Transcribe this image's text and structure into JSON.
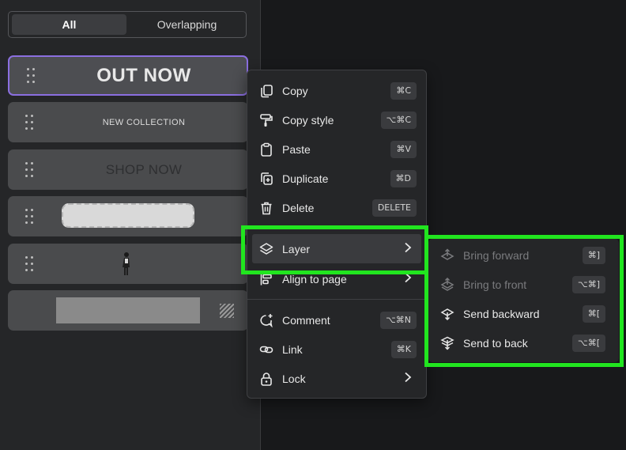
{
  "layers_panel": {
    "tabs": [
      {
        "label": "All",
        "selected": true
      },
      {
        "label": "Overlapping",
        "selected": false
      }
    ],
    "rows": [
      {
        "text": "OUT NOW",
        "selected": true
      },
      {
        "text": "NEW COLLECTION"
      },
      {
        "text": "SHOP NOW"
      },
      {
        "kind": "rounded-rectangle-shape"
      },
      {
        "kind": "person-photo"
      },
      {
        "kind": "rectangle-with-pattern"
      }
    ]
  },
  "context_menu": {
    "items": [
      {
        "label": "Copy",
        "shortcut": "⌘C",
        "icon": "copy-icon"
      },
      {
        "label": "Copy style",
        "shortcut": "⌥⌘C",
        "icon": "paint-roller-icon"
      },
      {
        "label": "Paste",
        "shortcut": "⌘V",
        "icon": "clipboard-icon"
      },
      {
        "label": "Duplicate",
        "shortcut": "⌘D",
        "icon": "duplicate-icon"
      },
      {
        "label": "Delete",
        "shortcut": "DELETE",
        "icon": "trash-icon"
      },
      {
        "label": "Layer",
        "icon": "layers-icon",
        "submenu": true,
        "highlighted": true
      },
      {
        "label": "Align to page",
        "icon": "align-icon",
        "submenu": true
      },
      {
        "label": "Comment",
        "shortcut": "⌥⌘N",
        "icon": "comment-icon"
      },
      {
        "label": "Link",
        "shortcut": "⌘K",
        "icon": "link-icon"
      },
      {
        "label": "Lock",
        "icon": "lock-icon",
        "submenu": true
      }
    ]
  },
  "layer_submenu": {
    "items": [
      {
        "label": "Bring forward",
        "shortcut": "⌘]",
        "disabled": true,
        "icon": "bring-forward-icon"
      },
      {
        "label": "Bring to front",
        "shortcut": "⌥⌘]",
        "disabled": true,
        "icon": "bring-to-front-icon"
      },
      {
        "label": "Send backward",
        "shortcut": "⌘[",
        "disabled": false,
        "icon": "send-backward-icon"
      },
      {
        "label": "Send to back",
        "shortcut": "⌥⌘[",
        "disabled": false,
        "icon": "send-to-back-icon"
      }
    ]
  },
  "colors": {
    "highlight_outline": "#21e51f",
    "selected_border": "#8b6fe0"
  }
}
